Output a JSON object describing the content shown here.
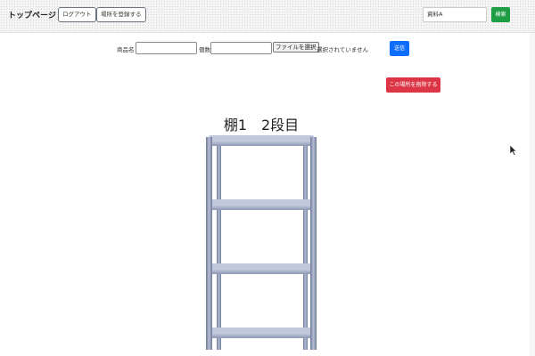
{
  "navbar": {
    "brand": "トップページ",
    "logout_label": "ログアウト",
    "register_place_label": "場所を登録する",
    "search": {
      "value": "資料A",
      "button_label": "検索"
    }
  },
  "form": {
    "product_name_label": "商品名",
    "product_name_value": "",
    "quantity_label": "個数",
    "quantity_value": "",
    "file_button_label": "ファイルを選択",
    "file_status": "選択されていません",
    "submit_label": "送信"
  },
  "delete_place_label": "この場所を削除する",
  "shelf": {
    "title": "棚1　2段目"
  },
  "colors": {
    "primary": "#0d6efd",
    "success": "#1f9d45",
    "danger": "#dc3545",
    "shelf_metal": "#8e98b5"
  }
}
